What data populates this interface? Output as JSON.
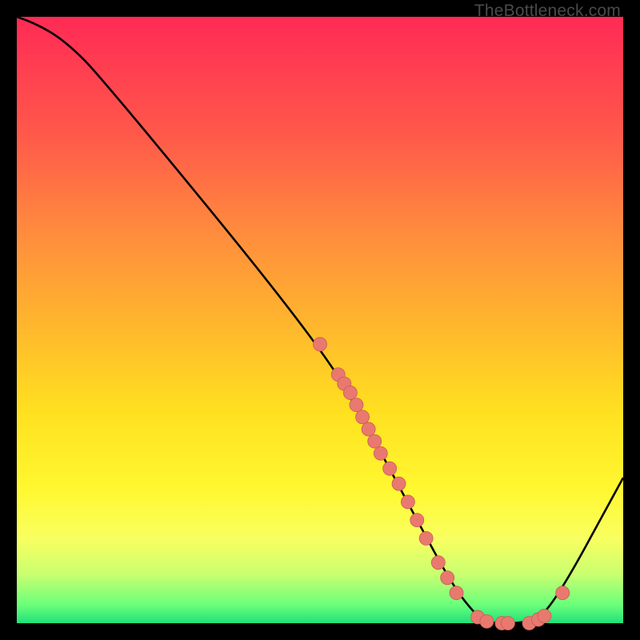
{
  "attribution": "TheBottleneck.com",
  "colors": {
    "black": "#000000",
    "curve": "#000000",
    "marker_fill": "#e9796f",
    "marker_stroke": "#c95b53",
    "gradient_stops": [
      "#ff2a55",
      "#ff5a4a",
      "#ff8a3e",
      "#ffb42e",
      "#ffe020",
      "#fff830",
      "#f9ff60",
      "#c8ff70",
      "#6aff7a",
      "#1fe07a"
    ]
  },
  "chart_data": {
    "type": "line",
    "title": "",
    "xlabel": "",
    "ylabel": "",
    "xlim": [
      0,
      100
    ],
    "ylim": [
      0,
      100
    ],
    "curve": [
      {
        "x": 0,
        "y": 100
      },
      {
        "x": 3,
        "y": 99
      },
      {
        "x": 8,
        "y": 96
      },
      {
        "x": 14,
        "y": 90
      },
      {
        "x": 50,
        "y": 46
      },
      {
        "x": 58,
        "y": 32
      },
      {
        "x": 66,
        "y": 17
      },
      {
        "x": 72,
        "y": 6
      },
      {
        "x": 76,
        "y": 1
      },
      {
        "x": 78,
        "y": 0
      },
      {
        "x": 84,
        "y": 0
      },
      {
        "x": 88,
        "y": 2
      },
      {
        "x": 100,
        "y": 24
      }
    ],
    "markers": [
      {
        "x": 50.0,
        "y": 46.0
      },
      {
        "x": 53.0,
        "y": 41.0
      },
      {
        "x": 54.0,
        "y": 39.5
      },
      {
        "x": 55.0,
        "y": 38.0
      },
      {
        "x": 56.0,
        "y": 36.0
      },
      {
        "x": 57.0,
        "y": 34.0
      },
      {
        "x": 58.0,
        "y": 32.0
      },
      {
        "x": 59.0,
        "y": 30.0
      },
      {
        "x": 60.0,
        "y": 28.0
      },
      {
        "x": 61.5,
        "y": 25.5
      },
      {
        "x": 63.0,
        "y": 23.0
      },
      {
        "x": 64.5,
        "y": 20.0
      },
      {
        "x": 66.0,
        "y": 17.0
      },
      {
        "x": 67.5,
        "y": 14.0
      },
      {
        "x": 69.5,
        "y": 10.0
      },
      {
        "x": 71.0,
        "y": 7.5
      },
      {
        "x": 72.5,
        "y": 5.0
      },
      {
        "x": 76.0,
        "y": 1.0
      },
      {
        "x": 77.5,
        "y": 0.3
      },
      {
        "x": 80.0,
        "y": 0.0
      },
      {
        "x": 81.0,
        "y": 0.0
      },
      {
        "x": 84.5,
        "y": 0.0
      },
      {
        "x": 86.0,
        "y": 0.6
      },
      {
        "x": 87.0,
        "y": 1.2
      },
      {
        "x": 90.0,
        "y": 5.0
      }
    ]
  }
}
